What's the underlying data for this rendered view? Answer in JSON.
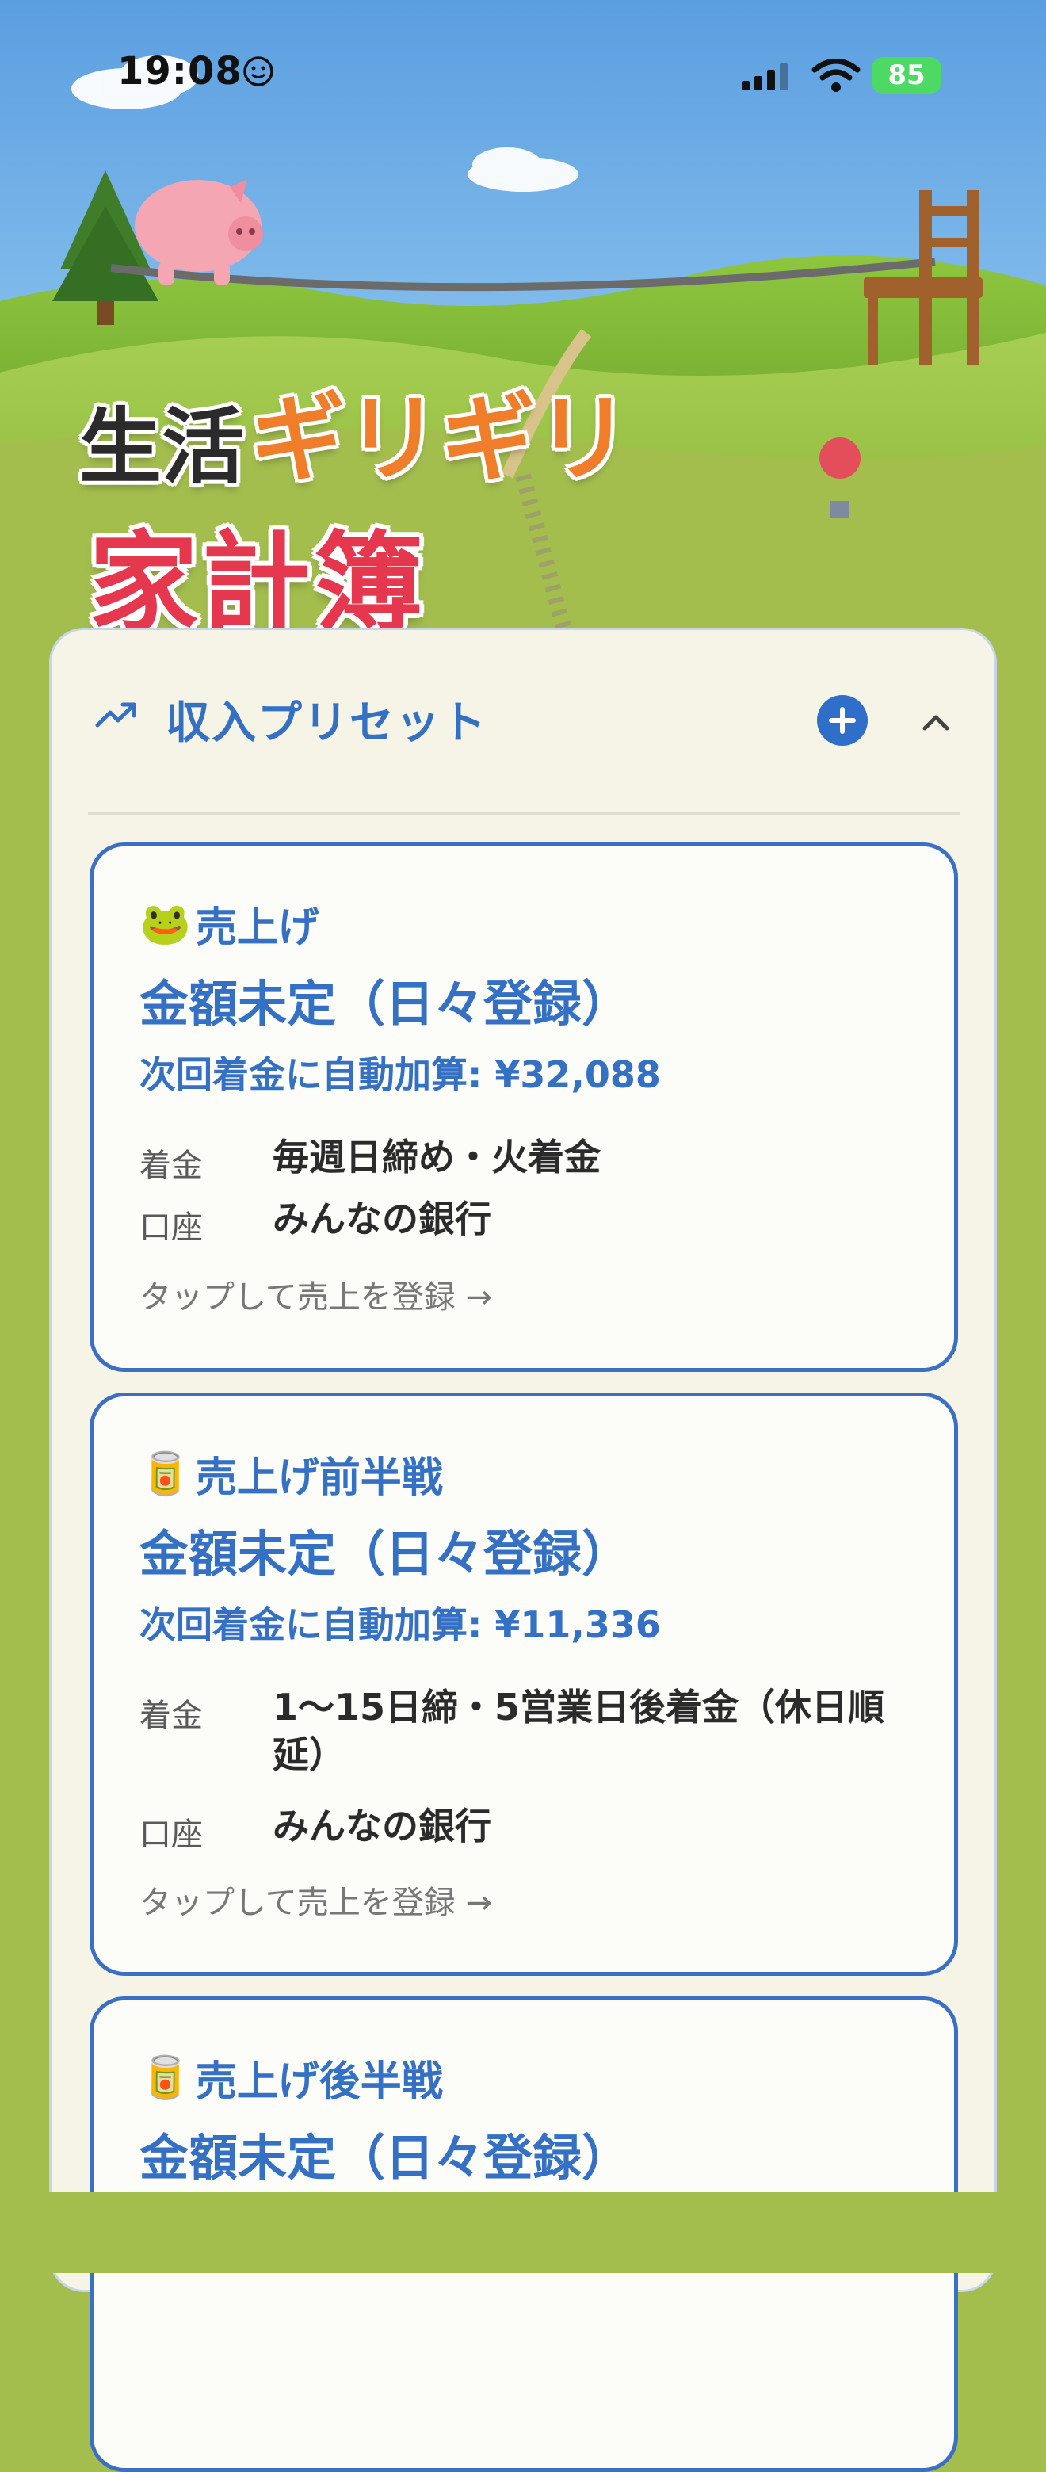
{
  "status_bar": {
    "time": "19:08",
    "battery": "85"
  },
  "app_title": {
    "part1": "生活",
    "part2": "ギリギリ",
    "part3": "家計簿"
  },
  "panel": {
    "title": "収入プリセット",
    "icons": {
      "header": "trending-up-icon",
      "add": "plus-circle-icon",
      "collapse": "chevron-up-icon"
    },
    "accent_color": "#3470c4"
  },
  "labels": {
    "deposit": "着金",
    "account": "口座"
  },
  "presets": [
    {
      "emoji": "🐸",
      "name": "売上げ",
      "amount": "金額未定（日々登録）",
      "next_deposit": "次回着金に自動加算: ¥32,088",
      "deposit_rule": "毎週日締め・火着金",
      "account": "みんなの銀行",
      "hint": "タップして売上を登録 →"
    },
    {
      "emoji": "🥫",
      "name": "売上げ前半戦",
      "amount": "金額未定（日々登録）",
      "next_deposit": "次回着金に自動加算: ¥11,336",
      "deposit_rule": "1〜15日締・5営業日後着金（休日順延）",
      "account": "みんなの銀行",
      "hint": "タップして売上を登録 →"
    },
    {
      "emoji": "🥫",
      "name": "売上げ後半戦",
      "amount": "金額未定（日々登録）"
    }
  ]
}
